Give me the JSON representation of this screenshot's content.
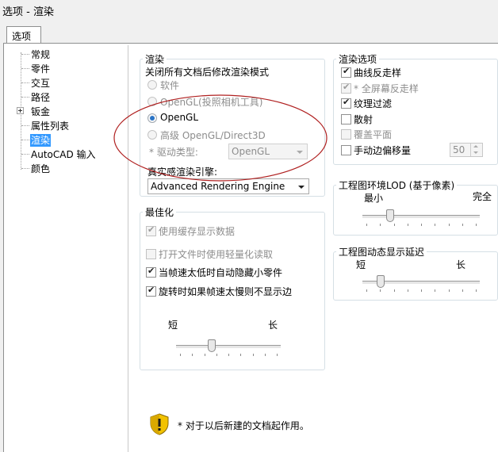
{
  "window": {
    "title": "选项 - 渲染"
  },
  "tabs": [
    {
      "label": "选项"
    }
  ],
  "tree": {
    "items": [
      "常规",
      "零件",
      "交互",
      "路径",
      "钣金",
      "属性列表",
      "渲染",
      "AutoCAD 输入",
      "颜色"
    ],
    "selected": "渲染"
  },
  "render_group": {
    "title": "渲染",
    "subtitle": "关闭所有文档后修改渲染模式",
    "options": [
      "软件",
      "OpenGL(投照相机工具)",
      "OpenGL",
      "高级 OpenGL/Direct3D"
    ],
    "selected": "OpenGL",
    "driver_label": "* 驱动类型:",
    "driver_value": "OpenGL",
    "engine_label": "真实感渲染引擎:",
    "engine_value": "Advanced Rendering Engine"
  },
  "render_options": {
    "title": "渲染选项",
    "curve_aa": "曲线反走样",
    "fullscreen_aa": "* 全屏幕反走样",
    "texture_filter": "纹理过滤",
    "scatter": "散射",
    "cover_plane": "覆盖平面",
    "manual_offset": "手动边偏移量",
    "offset_value": "50"
  },
  "lod": {
    "title": "工程图环境LOD (基于像素)",
    "min_label": "最小",
    "max_label": "完全",
    "value": 0.22
  },
  "dynamic_delay": {
    "title": "工程图动态显示延迟",
    "short_label": "短",
    "long_label": "长",
    "value": 0.13
  },
  "optimize": {
    "title": "最佳化",
    "cache_display": "使用缓存显示数据",
    "lightweight_read": "打开文件时使用轻量化读取",
    "hide_small_parts": "当帧速太低时自动隐藏小零件",
    "no_edges_rotate": "旋转时如果帧速太慢则不显示边",
    "short_label": "短",
    "long_label": "长",
    "value": 0.33
  },
  "footer": {
    "note": "* 对于以后新建的文档起作用。",
    "icon": "warning-shield-icon"
  }
}
